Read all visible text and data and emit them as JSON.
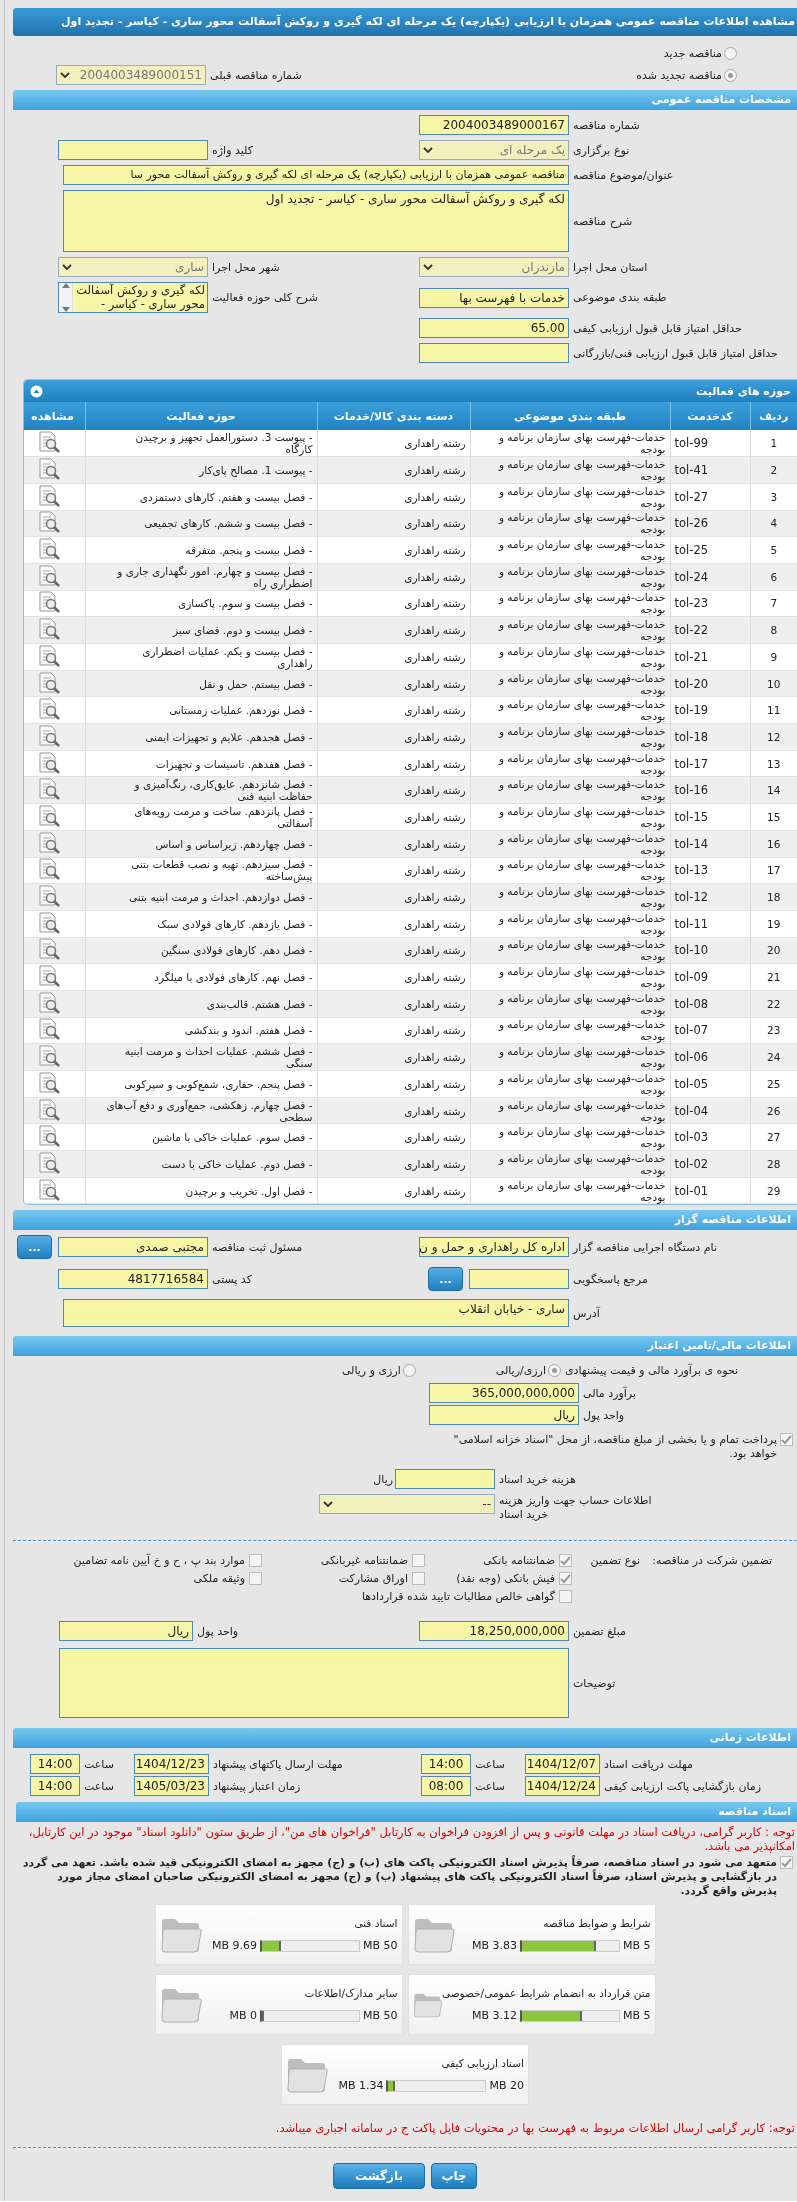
{
  "page_title": "مشاهده اطلاعات مناقصه عمومی همزمان با ارزیابی (یکپارچه) یک مرحله ای لکه گیری و روکش آسفالت محور ساری - کیاسر - تجدید اول",
  "tender_status": [
    {
      "label": "مناقصه جدید",
      "selected": false
    },
    {
      "label": "مناقصه تجدید شده",
      "selected": true
    }
  ],
  "previous_tender": {
    "label": "شماره مناقصه قبلی",
    "value": "2004003489000151"
  },
  "general": {
    "title": "مشخصات مناقصه عمومی",
    "rows": [
      [
        {
          "label": "شماره مناقصه",
          "value": "2004003489000167",
          "kind": "input"
        }
      ],
      [
        {
          "label": "نوع برگزاری",
          "value": "یک مرحله ای",
          "kind": "select"
        },
        {
          "label": "کلید واژه",
          "kind": "input"
        }
      ],
      [
        {
          "label": "عنوان/موضوع مناقصه",
          "value": "مناقصه عمومی همزمان با ارزیابی (یکپارچه) یک مرحله ای لکه گیری و روکش آسفالت محور سا",
          "kind": "wide"
        }
      ],
      [
        {
          "label": "شرح مناقصه",
          "value": "لکه گیری و روکش آسفالت محور ساری - کیاسر - تجدید اول",
          "kind": "textarea"
        }
      ],
      [
        {
          "label": "استان محل اجرا",
          "value": "مازندران",
          "kind": "select"
        },
        {
          "label": "شهر محل اجرا",
          "value": "ساری",
          "kind": "select"
        }
      ],
      [
        {
          "label": "طبقه بندی موضوعی",
          "value": "خدمات با فهرست بها",
          "kind": "input"
        },
        {
          "label": "شرح کلی حوزه فعالیت",
          "value": "لکه گیری و روکش آسفالت محور ساری - کیاسر -",
          "kind": "listbox"
        }
      ],
      [
        {
          "label": "حداقل امتیاز قابل قبول ارزیابی کیفی",
          "value": "65.00",
          "kind": "input"
        }
      ],
      [
        {
          "label": "حداقل امتیاز قابل قبول ارزیابی فنی/بازرگانی",
          "kind": "input"
        }
      ]
    ]
  },
  "activities": {
    "title": "حوزه های فعالیت",
    "columns": [
      "ردیف",
      "کدخدمت",
      "طبقه بندی موضوعی",
      "دسته بندی کالا/خدمات",
      "حوزه فعالیت",
      "مشاهده"
    ],
    "rows": [
      {
        "no": "1",
        "code": "tol-99",
        "category": "خدمات-فهرست بهای سازمان برنامه و بودجه",
        "group": "رشته راهداری",
        "activity": "- پیوست 3. دستورالعمل تجهیز و برچیدن کارگاه"
      },
      {
        "no": "2",
        "code": "tol-41",
        "category": "خدمات-فهرست بهای سازمان برنامه و بودجه",
        "group": "رشته راهداری",
        "activity": "- پیوست 1. مصالح پای‌کار"
      },
      {
        "no": "3",
        "code": "tol-27",
        "category": "خدمات-فهرست بهای سازمان برنامه و بودجه",
        "group": "رشته راهداری",
        "activity": "- فصل بیست و هفتم. کارهای دستمزدی"
      },
      {
        "no": "4",
        "code": "tol-26",
        "category": "خدمات-فهرست بهای سازمان برنامه و بودجه",
        "group": "رشته راهداری",
        "activity": "- فصل بیست و ششم. کارهای تجمیعی"
      },
      {
        "no": "5",
        "code": "tol-25",
        "category": "خدمات-فهرست بهای سازمان برنامه و بودجه",
        "group": "رشته راهداری",
        "activity": "- فصل بیست و پنجم. متفرقه"
      },
      {
        "no": "6",
        "code": "tol-24",
        "category": "خدمات-فهرست بهای سازمان برنامه و بودجه",
        "group": "رشته راهداری",
        "activity": "- فصل بیست و چهارم. امور نگهداری جاری و اضطراری راه"
      },
      {
        "no": "7",
        "code": "tol-23",
        "category": "خدمات-فهرست بهای سازمان برنامه و بودجه",
        "group": "رشته راهداری",
        "activity": "- فصل بیست و سوم. پاکسازی"
      },
      {
        "no": "8",
        "code": "tol-22",
        "category": "خدمات-فهرست بهای سازمان برنامه و بودجه",
        "group": "رشته راهداری",
        "activity": "- فصل بیست و دوم. فضای سبز"
      },
      {
        "no": "9",
        "code": "tol-21",
        "category": "خدمات-فهرست بهای سازمان برنامه و بودجه",
        "group": "رشته راهداری",
        "activity": "- فصل بیست و یکم. عملیات اضطراری راهداری"
      },
      {
        "no": "10",
        "code": "tol-20",
        "category": "خدمات-فهرست بهای سازمان برنامه و بودجه",
        "group": "رشته راهداری",
        "activity": "- فصل بیستم. حمل و نقل"
      },
      {
        "no": "11",
        "code": "tol-19",
        "category": "خدمات-فهرست بهای سازمان برنامه و بودجه",
        "group": "رشته راهداری",
        "activity": "- فصل نوزدهم. عملیات زمستانی"
      },
      {
        "no": "12",
        "code": "tol-18",
        "category": "خدمات-فهرست بهای سازمان برنامه و بودجه",
        "group": "رشته راهداری",
        "activity": "- فصل هجدهم. علایم و تجهیزات ایمنی"
      },
      {
        "no": "13",
        "code": "tol-17",
        "category": "خدمات-فهرست بهای سازمان برنامه و بودجه",
        "group": "رشته راهداری",
        "activity": "- فصل هفدهم. تاسیسات و تجهیزات"
      },
      {
        "no": "14",
        "code": "tol-16",
        "category": "خدمات-فهرست بهای سازمان برنامه و بودجه",
        "group": "رشته راهداری",
        "activity": "- فصل شانزدهم. عایق‌کاری، رنگ‌آمیزی و حفاظت ابنیه فنی"
      },
      {
        "no": "15",
        "code": "tol-15",
        "category": "خدمات-فهرست بهای سازمان برنامه و بودجه",
        "group": "رشته راهداری",
        "activity": "- فصل پانزدهم. ساخت و مرمت رویه‌های آسفالتی"
      },
      {
        "no": "16",
        "code": "tol-14",
        "category": "خدمات-فهرست بهای سازمان برنامه و بودجه",
        "group": "رشته راهداری",
        "activity": "- فصل چهاردهم. زیراساس و اساس"
      },
      {
        "no": "17",
        "code": "tol-13",
        "category": "خدمات-فهرست بهای سازمان برنامه و بودجه",
        "group": "رشته راهداری",
        "activity": "- فصل سیزدهم. تهیه و نصب قطعات بتنی پیش‌ساخته"
      },
      {
        "no": "18",
        "code": "tol-12",
        "category": "خدمات-فهرست بهای سازمان برنامه و بودجه",
        "group": "رشته راهداری",
        "activity": "- فصل دوازدهم. احداث و مرمت ابنیه بتنی"
      },
      {
        "no": "19",
        "code": "tol-11",
        "category": "خدمات-فهرست بهای سازمان برنامه و بودجه",
        "group": "رشته راهداری",
        "activity": "- فصل یازدهم. کارهای فولادی سبک"
      },
      {
        "no": "20",
        "code": "tol-10",
        "category": "خدمات-فهرست بهای سازمان برنامه و بودجه",
        "group": "رشته راهداری",
        "activity": "- فصل دهم. کارهای فولادی سنگین"
      },
      {
        "no": "21",
        "code": "tol-09",
        "category": "خدمات-فهرست بهای سازمان برنامه و بودجه",
        "group": "رشته راهداری",
        "activity": "- فصل نهم. کارهای فولادی با میلگرد"
      },
      {
        "no": "22",
        "code": "tol-08",
        "category": "خدمات-فهرست بهای سازمان برنامه و بودجه",
        "group": "رشته راهداری",
        "activity": "- فصل هشتم. قالب‌بندی"
      },
      {
        "no": "23",
        "code": "tol-07",
        "category": "خدمات-فهرست بهای سازمان برنامه و بودجه",
        "group": "رشته راهداری",
        "activity": "- فصل هفتم. اندود و بندکشی"
      },
      {
        "no": "24",
        "code": "tol-06",
        "category": "خدمات-فهرست بهای سازمان برنامه و بودجه",
        "group": "رشته راهداری",
        "activity": "- فصل ششم. عملیات احداث و مرمت ابنیه سنگی"
      },
      {
        "no": "25",
        "code": "tol-05",
        "category": "خدمات-فهرست بهای سازمان برنامه و بودجه",
        "group": "رشته راهداری",
        "activity": "- فصل پنجم. حفاری، شمع‌کوبی و سپرکوبی"
      },
      {
        "no": "26",
        "code": "tol-04",
        "category": "خدمات-فهرست بهای سازمان برنامه و بودجه",
        "group": "رشته راهداری",
        "activity": "- فصل چهارم. زهکشی، جمع‌آوری و دفع آب‌های سطحی"
      },
      {
        "no": "27",
        "code": "tol-03",
        "category": "خدمات-فهرست بهای سازمان برنامه و بودجه",
        "group": "رشته راهداری",
        "activity": "- فصل سوم. عملیات خاکی با ماشین"
      },
      {
        "no": "28",
        "code": "tol-02",
        "category": "خدمات-فهرست بهای سازمان برنامه و بودجه",
        "group": "رشته راهداری",
        "activity": "- فصل دوم. عملیات خاکی با دست"
      },
      {
        "no": "29",
        "code": "tol-01",
        "category": "خدمات-فهرست بهای سازمان برنامه و بودجه",
        "group": "رشته راهداری",
        "activity": "- فصل اول. تخریب و برچیدن"
      }
    ]
  },
  "organizer": {
    "title": "اطلاعات مناقصه گزار",
    "agency": {
      "label": "نام دستگاه اجرایی مناقصه گزار",
      "value": "اداره کل راهداری و حمل و ن"
    },
    "registrar": {
      "label": "مسئول ثبت مناقصه",
      "value": "مجتبی صمدی",
      "button": "..."
    },
    "responder": {
      "label": "مرجع پاسخگویی",
      "button": "..."
    },
    "postal_code": {
      "label": "کد پستی",
      "value": "4817716584"
    },
    "address": {
      "label": "آدرس",
      "value": "ساری - خیابان  انقلاب"
    }
  },
  "finance": {
    "title": "اطلاعات مالی/تامین اعتبار",
    "estimate_method": {
      "label": "نحوه ی برآورد مالی و قیمت پیشنهادی",
      "options": [
        {
          "label": "ارزی/ریالی",
          "selected": true
        },
        {
          "label": "ارزی و ریالی",
          "selected": false
        }
      ]
    },
    "estimate": {
      "label": "برآورد مالی",
      "value": "365,000,000,000"
    },
    "currency": {
      "label": "واحد پول",
      "value": "ریال"
    },
    "treasury": {
      "label": "پرداخت تمام و یا بخشی از مبلغ مناقصه، از محل \"اسناد خزانه اسلامی\" خواهد بود.",
      "checked": true
    },
    "doc_fee": {
      "label": "هزینه خرید اسناد",
      "unit": "ریال"
    },
    "account": {
      "label": "اطلاعات حساب جهت واریز هزینه خرید اسناد",
      "value": "--"
    }
  },
  "guarantee": {
    "label": "تضمین شرکت در مناقصه:",
    "type_label": "نوع تضمین",
    "options": [
      {
        "label": "ضمانتنامه بانکی",
        "checked": true
      },
      {
        "label": "ضمانتنامه غیربانکی",
        "checked": false
      },
      {
        "label": "موارد بند پ ، ح و خ آیین نامه تضامین",
        "checked": false
      },
      {
        "label": "فیش بانکی (وجه نقد)",
        "checked": true
      },
      {
        "label": "اوراق مشارکت",
        "checked": false
      },
      {
        "label": "وثیقه ملکی",
        "checked": false
      },
      {
        "label": "گواهی خالص مطالبات تایید شده قراردادها",
        "checked": false
      }
    ],
    "amount": {
      "label": "مبلغ تضمین",
      "value": "18,250,000,000"
    },
    "currency": {
      "label": "واحد پول",
      "value": "ریال"
    },
    "notes": {
      "label": "توضیحات"
    }
  },
  "schedule": {
    "title": "اطلاعات زمانی",
    "items": [
      {
        "label": "مهلت دریافت اسناد",
        "date": "1404/12/07",
        "time_label": "ساعت",
        "time": "14:00"
      },
      {
        "label": "مهلت ارسال پاکتهای پیشنهاد",
        "date": "1404/12/23",
        "time_label": "ساعت",
        "time": "14:00"
      },
      {
        "label": "زمان بازگشایی پاکت ارزیابی کیفی",
        "date": "1404/12/24",
        "time_label": "ساعت",
        "time": "08:00"
      },
      {
        "label": "زمان اعتبار پیشنهاد",
        "date": "1405/03/23",
        "time_label": "ساعت",
        "time": "14:00"
      }
    ]
  },
  "documents": {
    "title": "اسناد مناقصه",
    "notice": "توجه : کاربر گرامی، دریافت اسناد در مهلت قانونی و پس از افزودن فراخوان به کارتابل \"فراخوان های من\"، از طریق ستون \"دانلود اسناد\" موجود در این کارتابل، امکانپذیر می باشد.",
    "commitment": {
      "text": "متعهد می شود در اسناد مناقصه، صرفاً پذیرش اسناد الکترونیکی پاکت های (ب) و (ج) مجهز به امضای الکترونیکی قید شده باشد. تعهد می گردد در بازگشایی و پذیرش اسناد، صرفاً اسناد الکترونیکی پاکت های پیشنهاد (ب) و (ج) مجهز به امضای الکترونیکی صاحبان امضای مجاز مورد پذیرش واقع گردد.",
      "checked": true
    },
    "files": [
      {
        "title": "شرایط و ضوابط مناقصه",
        "used": "3.83 MB",
        "max": "5 MB",
        "level": 0.766
      },
      {
        "title": "اسناد فنی",
        "used": "9.69 MB",
        "max": "50 MB",
        "level": 0.194
      },
      {
        "title": "متن قرارداد به انضمام شرایط عمومی/خصوصی",
        "used": "3.12 MB",
        "max": "5 MB",
        "level": 0.624
      },
      {
        "title": "سایر مدارک/اطلاعات",
        "used": "0 MB",
        "max": "50 MB",
        "level": 0
      },
      {
        "title": "اسناد ارزیابی کیفی",
        "used": "1.34 MB",
        "max": "20 MB",
        "level": 0.067
      }
    ],
    "footer_note": "توجه: کاربر گرامی ارسال اطلاعات مربوط به فهرست بها در محتویات فایل پاکت ج در سامانه اجباری میباشد."
  },
  "buttons": [
    {
      "label": "چاپ"
    },
    {
      "label": "بازگشت"
    }
  ]
}
